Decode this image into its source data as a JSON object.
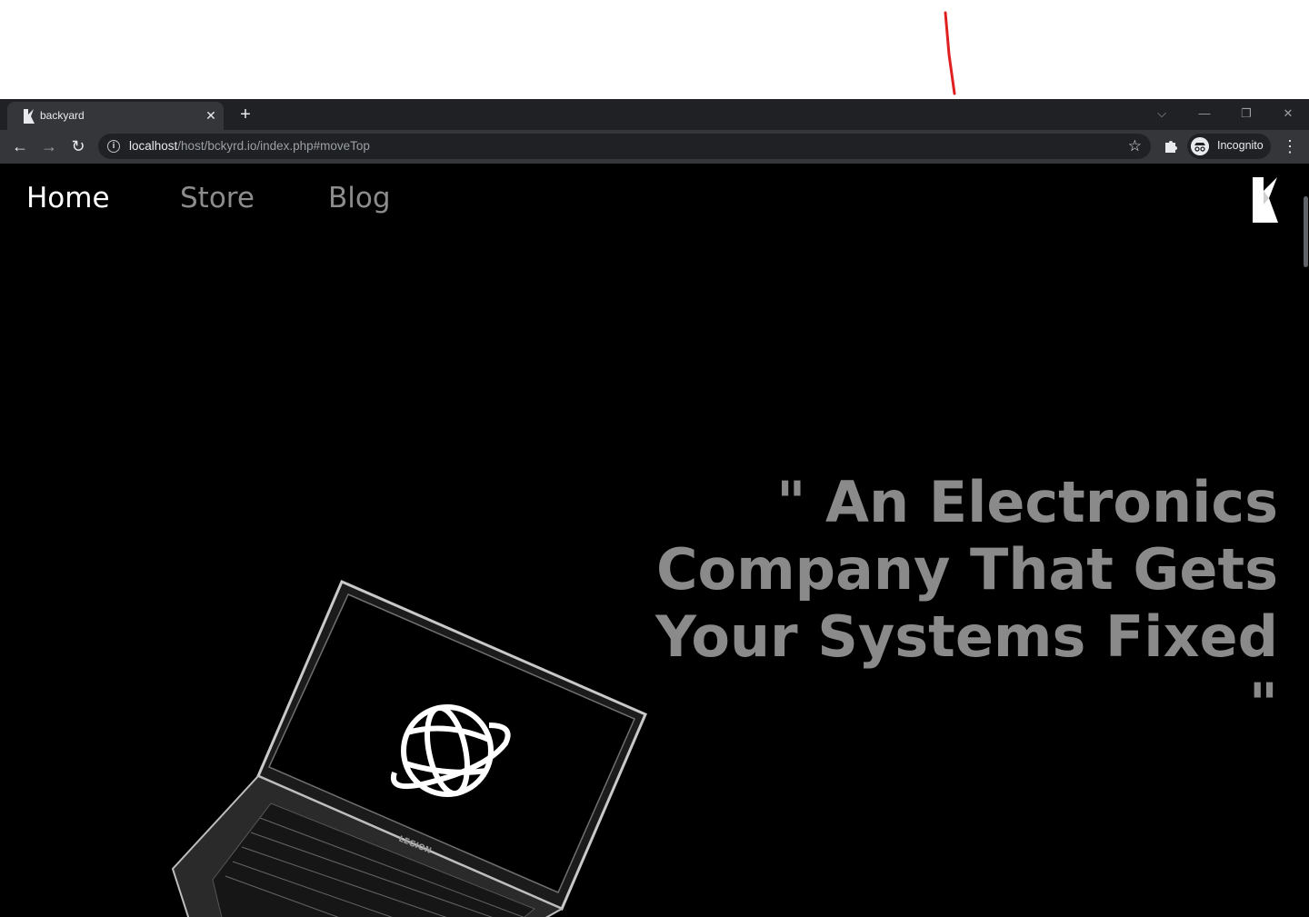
{
  "browser": {
    "tab": {
      "title": "backyard"
    },
    "address_bar": {
      "host": "localhost",
      "path": "/host/bckyrd.io/index.php#moveTop"
    },
    "profile": {
      "label": "Incognito"
    }
  },
  "site": {
    "nav": [
      {
        "label": "Home",
        "active": true
      },
      {
        "label": "Store",
        "active": false
      },
      {
        "label": "Blog",
        "active": false
      }
    ],
    "hero": {
      "quote": "\" An Electronics Company That Gets Your Systems Fixed \""
    },
    "laptop_brand": "LEGION"
  },
  "colors": {
    "page_bg": "#000000",
    "nav_active": "#ffffff",
    "nav_inactive": "#8c8c8c",
    "hero_text": "#8a8a8a",
    "browser_frame": "#202124",
    "annotation_red": "#e02020"
  },
  "icons": [
    "tab-favicon-icon",
    "close-icon",
    "plus-icon",
    "chevron-down-icon",
    "minimize-icon",
    "restore-icon",
    "window-close-icon",
    "back-arrow-icon",
    "forward-arrow-icon",
    "reload-icon",
    "info-icon",
    "star-icon",
    "puzzle-icon",
    "incognito-icon",
    "kebab-menu-icon",
    "site-logo-icon",
    "globe-icon"
  ]
}
